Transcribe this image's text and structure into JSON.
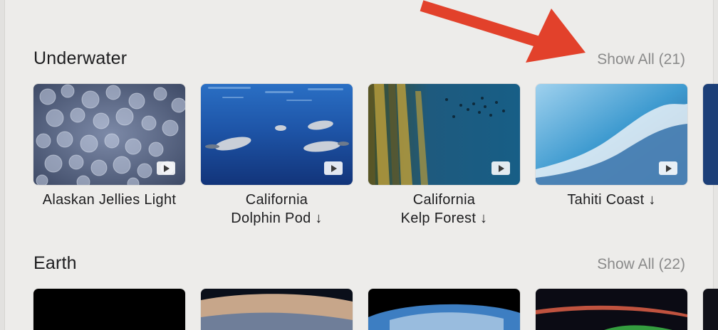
{
  "sections": [
    {
      "title": "Underwater",
      "show_all": "Show All (21)",
      "items": [
        {
          "line1": "Alaskan Jellies Light",
          "line2": ""
        },
        {
          "line1": "California",
          "line2": "Dolphin Pod ↓"
        },
        {
          "line1": "California",
          "line2": "Kelp Forest ↓"
        },
        {
          "line1": "Tahiti Coast ↓",
          "line2": ""
        }
      ]
    },
    {
      "title": "Earth",
      "show_all": "Show All (22)"
    }
  ],
  "icons": {
    "play": "play-badge-icon",
    "annotation": "red-arrow-annotation"
  },
  "colors": {
    "background": "#edecea",
    "annotation_arrow": "#e2412b",
    "secondary_text": "#8a8a8a"
  }
}
